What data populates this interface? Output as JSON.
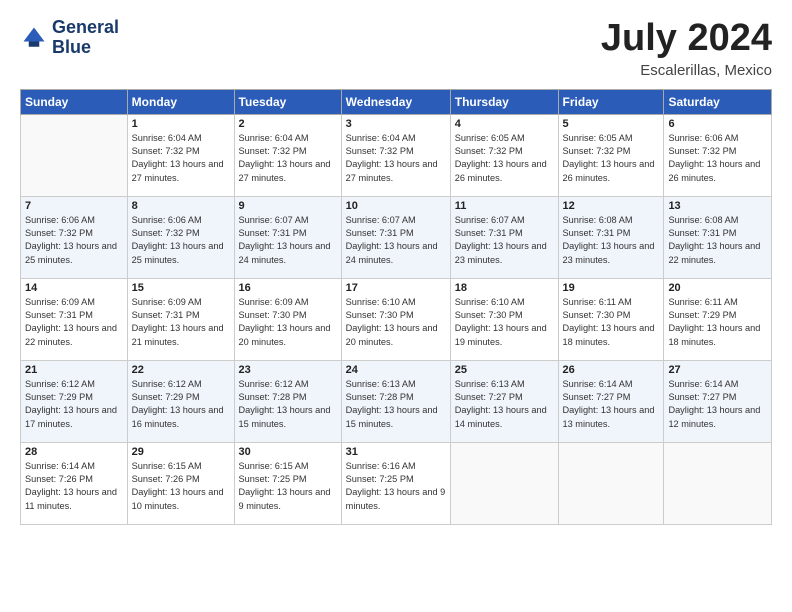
{
  "logo": {
    "line1": "General",
    "line2": "Blue"
  },
  "title": "July 2024",
  "location": "Escalerillas, Mexico",
  "header": {
    "days": [
      "Sunday",
      "Monday",
      "Tuesday",
      "Wednesday",
      "Thursday",
      "Friday",
      "Saturday"
    ]
  },
  "weeks": [
    [
      {
        "day": "",
        "sunrise": "",
        "sunset": "",
        "daylight": ""
      },
      {
        "day": "1",
        "sunrise": "Sunrise: 6:04 AM",
        "sunset": "Sunset: 7:32 PM",
        "daylight": "Daylight: 13 hours and 27 minutes."
      },
      {
        "day": "2",
        "sunrise": "Sunrise: 6:04 AM",
        "sunset": "Sunset: 7:32 PM",
        "daylight": "Daylight: 13 hours and 27 minutes."
      },
      {
        "day": "3",
        "sunrise": "Sunrise: 6:04 AM",
        "sunset": "Sunset: 7:32 PM",
        "daylight": "Daylight: 13 hours and 27 minutes."
      },
      {
        "day": "4",
        "sunrise": "Sunrise: 6:05 AM",
        "sunset": "Sunset: 7:32 PM",
        "daylight": "Daylight: 13 hours and 26 minutes."
      },
      {
        "day": "5",
        "sunrise": "Sunrise: 6:05 AM",
        "sunset": "Sunset: 7:32 PM",
        "daylight": "Daylight: 13 hours and 26 minutes."
      },
      {
        "day": "6",
        "sunrise": "Sunrise: 6:06 AM",
        "sunset": "Sunset: 7:32 PM",
        "daylight": "Daylight: 13 hours and 26 minutes."
      }
    ],
    [
      {
        "day": "7",
        "sunrise": "Sunrise: 6:06 AM",
        "sunset": "Sunset: 7:32 PM",
        "daylight": "Daylight: 13 hours and 25 minutes."
      },
      {
        "day": "8",
        "sunrise": "Sunrise: 6:06 AM",
        "sunset": "Sunset: 7:32 PM",
        "daylight": "Daylight: 13 hours and 25 minutes."
      },
      {
        "day": "9",
        "sunrise": "Sunrise: 6:07 AM",
        "sunset": "Sunset: 7:31 PM",
        "daylight": "Daylight: 13 hours and 24 minutes."
      },
      {
        "day": "10",
        "sunrise": "Sunrise: 6:07 AM",
        "sunset": "Sunset: 7:31 PM",
        "daylight": "Daylight: 13 hours and 24 minutes."
      },
      {
        "day": "11",
        "sunrise": "Sunrise: 6:07 AM",
        "sunset": "Sunset: 7:31 PM",
        "daylight": "Daylight: 13 hours and 23 minutes."
      },
      {
        "day": "12",
        "sunrise": "Sunrise: 6:08 AM",
        "sunset": "Sunset: 7:31 PM",
        "daylight": "Daylight: 13 hours and 23 minutes."
      },
      {
        "day": "13",
        "sunrise": "Sunrise: 6:08 AM",
        "sunset": "Sunset: 7:31 PM",
        "daylight": "Daylight: 13 hours and 22 minutes."
      }
    ],
    [
      {
        "day": "14",
        "sunrise": "Sunrise: 6:09 AM",
        "sunset": "Sunset: 7:31 PM",
        "daylight": "Daylight: 13 hours and 22 minutes."
      },
      {
        "day": "15",
        "sunrise": "Sunrise: 6:09 AM",
        "sunset": "Sunset: 7:31 PM",
        "daylight": "Daylight: 13 hours and 21 minutes."
      },
      {
        "day": "16",
        "sunrise": "Sunrise: 6:09 AM",
        "sunset": "Sunset: 7:30 PM",
        "daylight": "Daylight: 13 hours and 20 minutes."
      },
      {
        "day": "17",
        "sunrise": "Sunrise: 6:10 AM",
        "sunset": "Sunset: 7:30 PM",
        "daylight": "Daylight: 13 hours and 20 minutes."
      },
      {
        "day": "18",
        "sunrise": "Sunrise: 6:10 AM",
        "sunset": "Sunset: 7:30 PM",
        "daylight": "Daylight: 13 hours and 19 minutes."
      },
      {
        "day": "19",
        "sunrise": "Sunrise: 6:11 AM",
        "sunset": "Sunset: 7:30 PM",
        "daylight": "Daylight: 13 hours and 18 minutes."
      },
      {
        "day": "20",
        "sunrise": "Sunrise: 6:11 AM",
        "sunset": "Sunset: 7:29 PM",
        "daylight": "Daylight: 13 hours and 18 minutes."
      }
    ],
    [
      {
        "day": "21",
        "sunrise": "Sunrise: 6:12 AM",
        "sunset": "Sunset: 7:29 PM",
        "daylight": "Daylight: 13 hours and 17 minutes."
      },
      {
        "day": "22",
        "sunrise": "Sunrise: 6:12 AM",
        "sunset": "Sunset: 7:29 PM",
        "daylight": "Daylight: 13 hours and 16 minutes."
      },
      {
        "day": "23",
        "sunrise": "Sunrise: 6:12 AM",
        "sunset": "Sunset: 7:28 PM",
        "daylight": "Daylight: 13 hours and 15 minutes."
      },
      {
        "day": "24",
        "sunrise": "Sunrise: 6:13 AM",
        "sunset": "Sunset: 7:28 PM",
        "daylight": "Daylight: 13 hours and 15 minutes."
      },
      {
        "day": "25",
        "sunrise": "Sunrise: 6:13 AM",
        "sunset": "Sunset: 7:27 PM",
        "daylight": "Daylight: 13 hours and 14 minutes."
      },
      {
        "day": "26",
        "sunrise": "Sunrise: 6:14 AM",
        "sunset": "Sunset: 7:27 PM",
        "daylight": "Daylight: 13 hours and 13 minutes."
      },
      {
        "day": "27",
        "sunrise": "Sunrise: 6:14 AM",
        "sunset": "Sunset: 7:27 PM",
        "daylight": "Daylight: 13 hours and 12 minutes."
      }
    ],
    [
      {
        "day": "28",
        "sunrise": "Sunrise: 6:14 AM",
        "sunset": "Sunset: 7:26 PM",
        "daylight": "Daylight: 13 hours and 11 minutes."
      },
      {
        "day": "29",
        "sunrise": "Sunrise: 6:15 AM",
        "sunset": "Sunset: 7:26 PM",
        "daylight": "Daylight: 13 hours and 10 minutes."
      },
      {
        "day": "30",
        "sunrise": "Sunrise: 6:15 AM",
        "sunset": "Sunset: 7:25 PM",
        "daylight": "Daylight: 13 hours and 9 minutes."
      },
      {
        "day": "31",
        "sunrise": "Sunrise: 6:16 AM",
        "sunset": "Sunset: 7:25 PM",
        "daylight": "Daylight: 13 hours and 9 minutes."
      },
      {
        "day": "",
        "sunrise": "",
        "sunset": "",
        "daylight": ""
      },
      {
        "day": "",
        "sunrise": "",
        "sunset": "",
        "daylight": ""
      },
      {
        "day": "",
        "sunrise": "",
        "sunset": "",
        "daylight": ""
      }
    ]
  ]
}
